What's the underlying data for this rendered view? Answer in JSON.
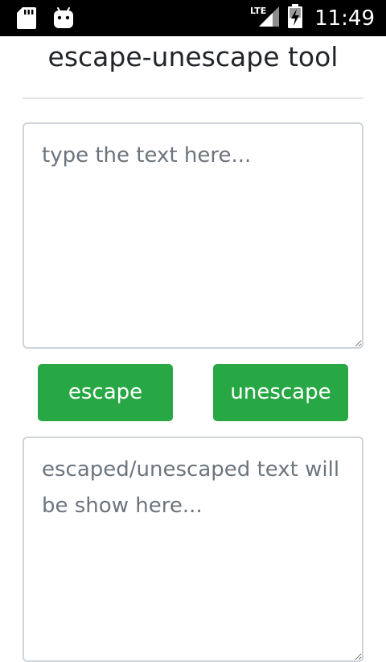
{
  "status_bar": {
    "time": "11:49",
    "network_label": "LTE",
    "icons": [
      "sd-card-icon",
      "android-icon",
      "lte-signal-icon",
      "battery-icon"
    ]
  },
  "app": {
    "title": "escape-unescape tool"
  },
  "input": {
    "value": "",
    "placeholder": "type the text here..."
  },
  "buttons": {
    "escape_label": "escape",
    "unescape_label": "unescape"
  },
  "output": {
    "value": "",
    "placeholder": "escaped/unescaped text will be show here..."
  },
  "colors": {
    "button": "#28a745",
    "status_bar": "#000000",
    "placeholder_text": "#6c757d",
    "border": "#ced4da"
  }
}
